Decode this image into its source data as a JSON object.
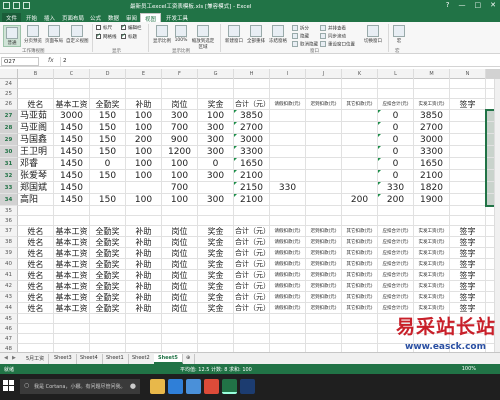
{
  "window": {
    "title": "最新员工excel工资表模板.xls [兼容模式] - Excel",
    "controls": [
      "?",
      "—",
      "□",
      "✕"
    ]
  },
  "ribbon_tabs": [
    {
      "label": "文件",
      "active": false
    },
    {
      "label": "开始",
      "active": false
    },
    {
      "label": "插入",
      "active": false
    },
    {
      "label": "页面布局",
      "active": false
    },
    {
      "label": "公式",
      "active": false
    },
    {
      "label": "数据",
      "active": false
    },
    {
      "label": "审阅",
      "active": false
    },
    {
      "label": "视图",
      "active": true
    },
    {
      "label": "开发工具",
      "active": false
    }
  ],
  "ribbon": {
    "btn_normal": "普通",
    "btn_pagebreak": "分页预览",
    "btn_pagelayout": "页面布局",
    "btn_customview": "自定义视图",
    "chk_ruler": "标尺",
    "chk_gridlines": "网格线",
    "chk_formulabar": "编辑栏",
    "chk_headings": "标题",
    "btn_zoom": "显示比例",
    "btn_100": "100%",
    "btn_zoomsel": "缩放到选定区域",
    "btn_newwin": "新建窗口",
    "btn_arrange": "全部重排",
    "btn_freeze": "冻结窗格",
    "btn_split": "拆分",
    "btn_hide": "隐藏",
    "btn_unhide": "取消隐藏",
    "btn_sidebyside": "并排查看",
    "btn_syncscroll": "同步滚动",
    "btn_resetpos": "重设窗口位置",
    "btn_switch": "切换窗口",
    "btn_macro": "宏",
    "group_views": "工作簿视图",
    "group_show": "显示",
    "group_zoom": "显示比例",
    "group_window": "窗口",
    "group_macro": "宏"
  },
  "formula_bar": {
    "name_box": "O27",
    "fx": "fx",
    "value": "2"
  },
  "columns": [
    "B",
    "C",
    "D",
    "E",
    "F",
    "G",
    "H",
    "I",
    "J",
    "K",
    "L",
    "M",
    "N",
    "O"
  ],
  "selected_column": "O",
  "header_row": [
    "姓名",
    "基本工资",
    "全勤奖",
    "补助",
    "岗位",
    "奖金",
    "合计（元）",
    "请假扣款(元)",
    "迟到扣款(元)",
    "其它扣款(元)",
    "应扣合计(元)",
    "实发工资(元)",
    "签字"
  ],
  "rows": [
    {
      "num": "24",
      "kind": "empty"
    },
    {
      "num": "25",
      "kind": "empty"
    },
    {
      "num": "26",
      "kind": "header",
      "o": ""
    },
    {
      "num": "27",
      "kind": "data",
      "cells": [
        "马亚茹",
        "3000",
        "150",
        "100",
        "300",
        "100",
        "3850",
        "",
        "",
        "",
        "0",
        "3850",
        ""
      ],
      "o": "2"
    },
    {
      "num": "28",
      "kind": "data",
      "cells": [
        "马亚阁",
        "1450",
        "150",
        "100",
        "700",
        "300",
        "2700",
        "",
        "",
        "",
        "0",
        "2700",
        ""
      ],
      "o": "5"
    },
    {
      "num": "29",
      "kind": "data",
      "cells": [
        "马国鑫",
        "1450",
        "150",
        "200",
        "900",
        "300",
        "3000",
        "",
        "",
        "",
        "0",
        "3000",
        ""
      ],
      "o": "8"
    },
    {
      "num": "30",
      "kind": "data",
      "cells": [
        "王卫明",
        "1450",
        "150",
        "100",
        "1200",
        "300",
        "3300",
        "",
        "",
        "",
        "0",
        "3300",
        ""
      ],
      "o": "11"
    },
    {
      "num": "31",
      "kind": "data",
      "cells": [
        "邓睿",
        "1450",
        "0",
        "100",
        "100",
        "0",
        "1650",
        "",
        "",
        "",
        "0",
        "1650",
        ""
      ],
      "o": "14"
    },
    {
      "num": "32",
      "kind": "data",
      "cells": [
        "张爱琴",
        "1450",
        "150",
        "100",
        "100",
        "300",
        "2100",
        "",
        "",
        "",
        "0",
        "2100",
        ""
      ],
      "o": "17"
    },
    {
      "num": "33",
      "kind": "data",
      "cells": [
        "郑国斌",
        "1450",
        "",
        "",
        "700",
        "",
        "2150",
        "330",
        "",
        "",
        "330",
        "1820",
        ""
      ],
      "o": "20"
    },
    {
      "num": "34",
      "kind": "data",
      "cells": [
        "高阳",
        "1450",
        "150",
        "100",
        "100",
        "300",
        "2100",
        "",
        "",
        "200",
        "200",
        "1900",
        ""
      ],
      "o": "23"
    },
    {
      "num": "35",
      "kind": "empty"
    },
    {
      "num": "36",
      "kind": "empty"
    },
    {
      "num": "37",
      "kind": "header",
      "o": "1"
    },
    {
      "num": "38",
      "kind": "header",
      "o": "4"
    },
    {
      "num": "39",
      "kind": "header",
      "o": "7"
    },
    {
      "num": "40",
      "kind": "header",
      "o": "10"
    },
    {
      "num": "41",
      "kind": "header",
      "o": "13"
    },
    {
      "num": "42",
      "kind": "header",
      "o": "16"
    },
    {
      "num": "43",
      "kind": "header",
      "o": "19"
    },
    {
      "num": "44",
      "kind": "header",
      "o": "22"
    },
    {
      "num": "45",
      "kind": "empty"
    },
    {
      "num": "46",
      "kind": "empty"
    },
    {
      "num": "47",
      "kind": "empty"
    },
    {
      "num": "48",
      "kind": "empty"
    }
  ],
  "sheet_tabs": [
    {
      "label": "5月工资",
      "active": false
    },
    {
      "label": "Sheet3",
      "active": false
    },
    {
      "label": "Sheet4",
      "active": false
    },
    {
      "label": "Sheet1",
      "active": false
    },
    {
      "label": "Sheet2",
      "active": false
    },
    {
      "label": "Sheet5",
      "active": true
    },
    {
      "label": "⊕",
      "active": false
    }
  ],
  "status": {
    "ready": "就绪",
    "mid": "平均值: 12.5    计数: 8    求和: 100",
    "zoom": "100%"
  },
  "taskbar": {
    "search_text": "我是 Cortana，小娜。有问题尽管问我。",
    "apps": [
      "explorer-icon",
      "edge-icon",
      "store-icon",
      "chrome-icon",
      "excel-icon",
      "ps-icon"
    ]
  },
  "watermark": {
    "title": "易采站长站",
    "url": "www.easck.com"
  },
  "colors": {
    "excel_green": "#217346",
    "selection_fill": "#c9d3cc"
  }
}
